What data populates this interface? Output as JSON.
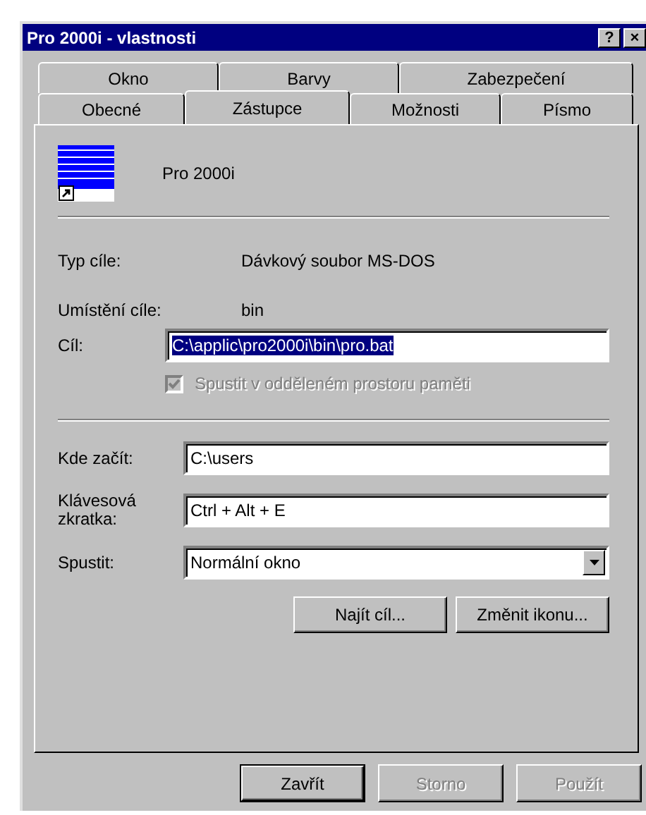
{
  "window": {
    "title": "Pro 2000i - vlastnosti",
    "title_buttons": [
      "?",
      "×"
    ]
  },
  "tab_rows": [
    [
      {
        "label": "Okno",
        "selected": false
      },
      {
        "label": "Barvy",
        "selected": false
      },
      {
        "label": "Zabezpečení",
        "selected": false
      }
    ],
    [
      {
        "label": "Obecné",
        "selected": false
      },
      {
        "label": "Zástupce",
        "selected": true
      },
      {
        "label": "Možnosti",
        "selected": false
      },
      {
        "label": "Písmo",
        "selected": false
      }
    ]
  ],
  "shortcut": {
    "name": "Pro 2000i"
  },
  "info": [
    {
      "label": "Typ cíle:",
      "value": "Dávkový soubor MS-DOS"
    },
    {
      "label": "Umístění cíle:",
      "value": "bin"
    }
  ],
  "target": {
    "label": "Cíl:",
    "value": "C:\\applic\\pro2000i\\bin\\pro.bat",
    "selected": true
  },
  "separate_memory": {
    "label": "Spustit v odděleném prostoru paměti",
    "checked": true,
    "disabled": true
  },
  "fields": [
    {
      "kind": "text",
      "label": "Kde začít:",
      "value": "C:\\users"
    },
    {
      "kind": "text",
      "label": "Klávesová zkratka:",
      "value": "Ctrl + Alt + E"
    },
    {
      "kind": "dropdown",
      "label": "Spustit:",
      "value": "Normální okno"
    }
  ],
  "action_buttons": [
    "Najít cíl...",
    "Změnit ikonu..."
  ],
  "dialog_buttons": [
    {
      "label": "Zavřít",
      "default": true,
      "disabled": false
    },
    {
      "label": "Storno",
      "default": false,
      "disabled": true
    },
    {
      "label": "Použít",
      "default": false,
      "disabled": true
    }
  ]
}
